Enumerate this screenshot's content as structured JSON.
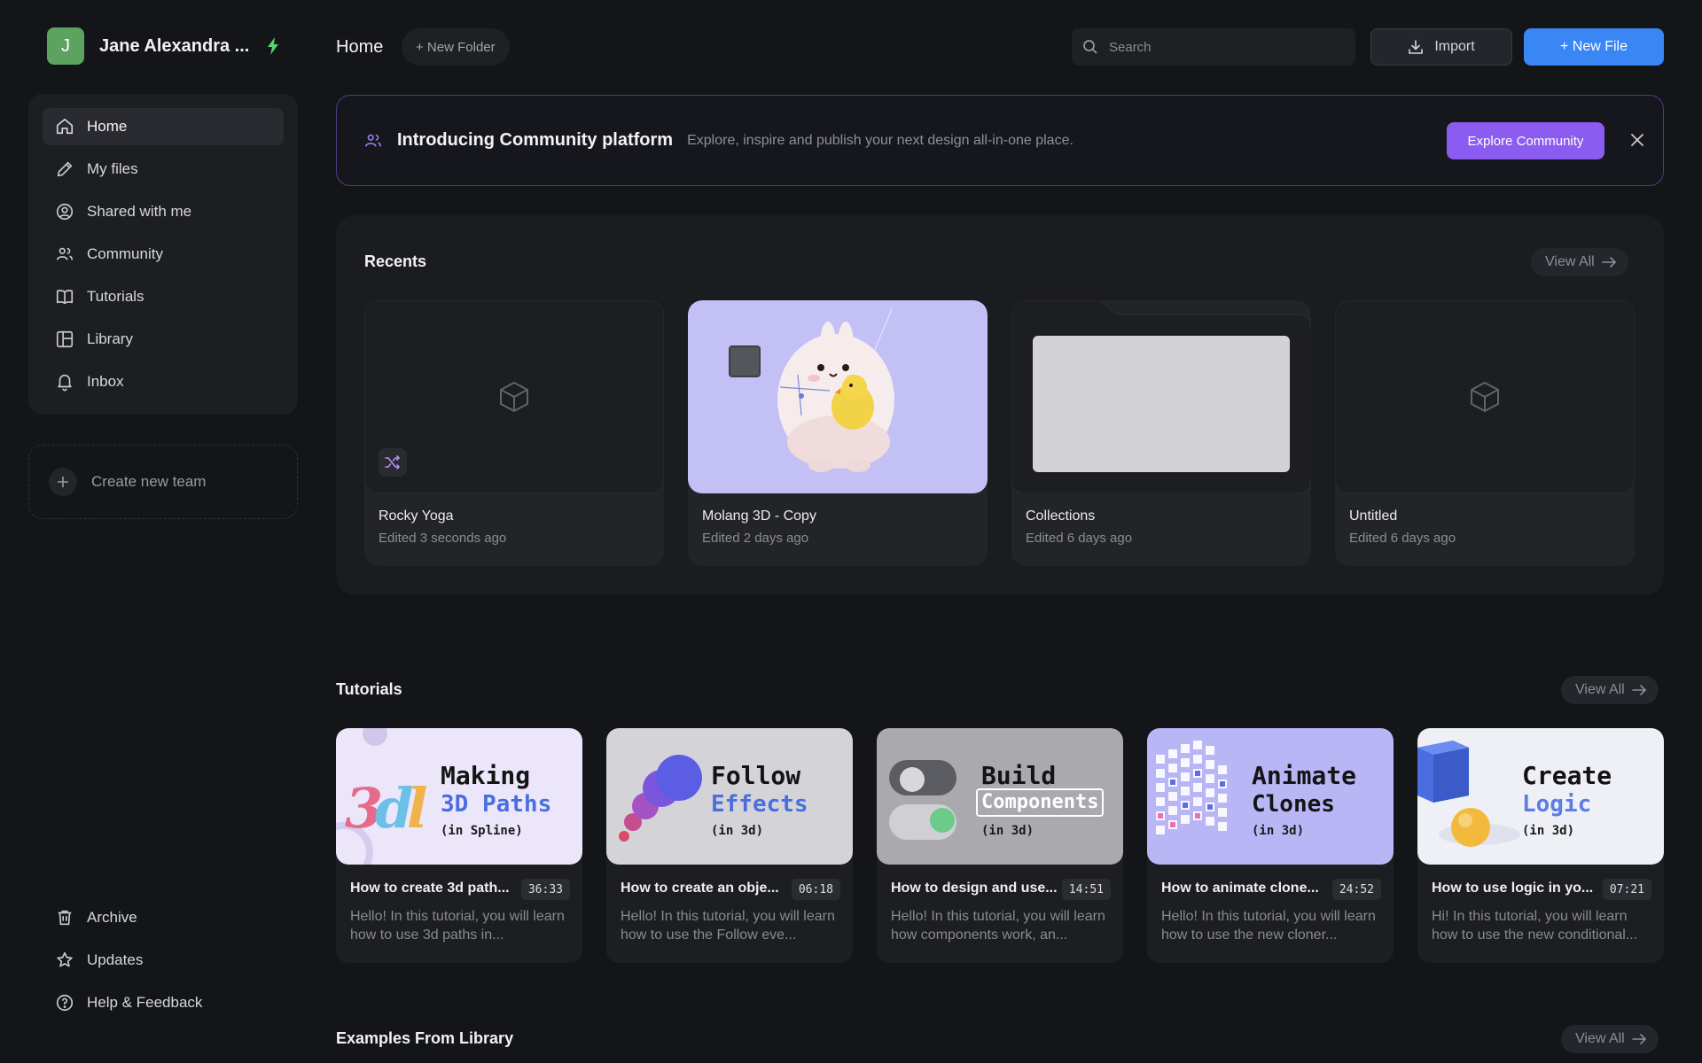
{
  "user": {
    "initial": "J",
    "name": "Jane Alexandra ..."
  },
  "sidebar": {
    "items": [
      {
        "label": "Home",
        "icon": "home-icon"
      },
      {
        "label": "My files",
        "icon": "pencil-icon"
      },
      {
        "label": "Shared with me",
        "icon": "user-circle-icon"
      },
      {
        "label": "Community",
        "icon": "users-icon"
      },
      {
        "label": "Tutorials",
        "icon": "book-icon"
      },
      {
        "label": "Library",
        "icon": "layout-icon"
      },
      {
        "label": "Inbox",
        "icon": "bell-icon"
      }
    ],
    "create_team": "Create new team",
    "bottom": [
      {
        "label": "Archive",
        "icon": "trash-icon"
      },
      {
        "label": "Updates",
        "icon": "star-icon"
      },
      {
        "label": "Help & Feedback",
        "icon": "help-icon"
      }
    ]
  },
  "header": {
    "title": "Home",
    "new_folder": "+ New Folder",
    "search_placeholder": "Search",
    "import": "Import",
    "new_file": "+ New File"
  },
  "banner": {
    "title": "Introducing Community platform",
    "description": "Explore, inspire and publish your next design all-in-one place.",
    "button": "Explore Community"
  },
  "recents": {
    "title": "Recents",
    "view_all": "View All",
    "files": [
      {
        "name": "Rocky Yoga",
        "edited": "Edited 3 seconds ago"
      },
      {
        "name": "Molang 3D - Copy",
        "edited": "Edited 2 days ago"
      },
      {
        "name": "Collections",
        "edited": "Edited 6 days ago"
      },
      {
        "name": "Untitled",
        "edited": "Edited 6 days ago"
      }
    ]
  },
  "tutorials": {
    "title": "Tutorials",
    "view_all": "View All",
    "items": [
      {
        "thumb_line1": "Making",
        "thumb_line2": "3D Paths",
        "thumb_line3": "(in Spline)",
        "name": "How to create 3d path...",
        "duration": "36:33",
        "description": "Hello! In this tutorial, you will learn how to use 3d paths in...",
        "accent": "#4a6ee0"
      },
      {
        "thumb_line1": "Follow",
        "thumb_line2": "Effects",
        "thumb_line3": "(in 3d)",
        "name": "How to create an obje...",
        "duration": "06:18",
        "description": "Hello! In this tutorial, you will learn how to use the Follow eve...",
        "accent": "#4a6ee0"
      },
      {
        "thumb_line1": "Build",
        "thumb_line2": "Components",
        "thumb_line3": "(in 3d)",
        "name": "How to design and use...",
        "duration": "14:51",
        "description": "Hello! In this tutorial, you will learn how components work, an...",
        "accent": "#ffffff"
      },
      {
        "thumb_line1": "Animate",
        "thumb_line2": "Clones",
        "thumb_line3": "(in 3d)",
        "name": "How to animate clone...",
        "duration": "24:52",
        "description": "Hello! In this tutorial, you will learn how to use the new cloner...",
        "accent": "#141414"
      },
      {
        "thumb_line1": "Create",
        "thumb_line2": "Logic",
        "thumb_line3": "(in 3d)",
        "name": "How to use logic in yo...",
        "duration": "07:21",
        "description": "Hi! In this tutorial, you will learn how to use the new conditional...",
        "accent": "#5b7de6"
      }
    ]
  },
  "examples": {
    "title": "Examples From Library",
    "view_all": "View All"
  },
  "colors": {
    "accent_blue": "#3a86f5",
    "accent_purple": "#8c5cf0",
    "avatar_green": "#5ba35f"
  }
}
